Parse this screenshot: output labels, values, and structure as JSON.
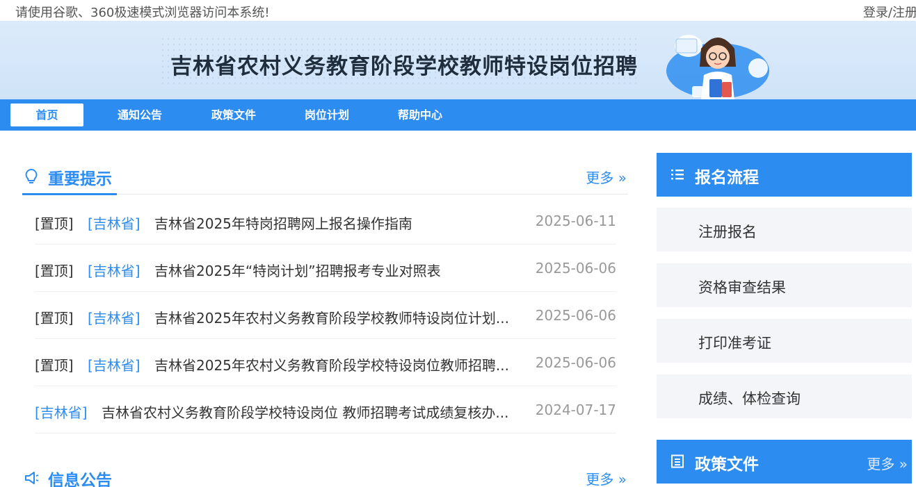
{
  "topbar": {
    "notice": "请使用谷歌、360极速模式浏览器访问本系统!",
    "login": "登录/注册"
  },
  "banner": {
    "title": "吉林省农村义务教育阶段学校教师特设岗位招聘"
  },
  "nav": {
    "items": [
      {
        "label": "首页",
        "active": true
      },
      {
        "label": "通知公告"
      },
      {
        "label": "政策文件"
      },
      {
        "label": "岗位计划"
      },
      {
        "label": "帮助中心"
      }
    ]
  },
  "important": {
    "title": "重要提示",
    "more": "更多 »",
    "rows": [
      {
        "pin": "[置顶]",
        "region": "[吉林省]",
        "title": "吉林省2025年特岗招聘网上报名操作指南",
        "date": "2025-06-11"
      },
      {
        "pin": "[置顶]",
        "region": "[吉林省]",
        "title": "吉林省2025年“特岗计划”招聘报考专业对照表",
        "date": "2025-06-06"
      },
      {
        "pin": "[置顶]",
        "region": "[吉林省]",
        "title": "吉林省2025年农村义务教育阶段学校教师特设岗位计划...",
        "date": "2025-06-06"
      },
      {
        "pin": "[置顶]",
        "region": "[吉林省]",
        "title": "吉林省2025年农村义务教育阶段学校特设岗位教师招聘...",
        "date": "2025-06-06"
      },
      {
        "pin": "",
        "region": "[吉林省]",
        "title": "吉林省农村义务教育阶段学校特设岗位 教师招聘考试成绩复核办...",
        "date": "2024-07-17"
      }
    ]
  },
  "info": {
    "title": "信息公告",
    "more": "更多 »"
  },
  "process": {
    "title": "报名流程",
    "items": [
      "注册报名",
      "资格审查结果",
      "打印准考证",
      "成绩、体检查询"
    ]
  },
  "policy": {
    "title": "政策文件",
    "more": "更多 »"
  },
  "colors": {
    "accent": "#2d8cf0",
    "banner_bg": "#d6e7fa",
    "side_item_bg": "#f3f5f8"
  },
  "icons": {
    "important": "lightbulb-icon",
    "info": "megaphone-icon",
    "process": "list-icon",
    "policy": "document-icon"
  }
}
